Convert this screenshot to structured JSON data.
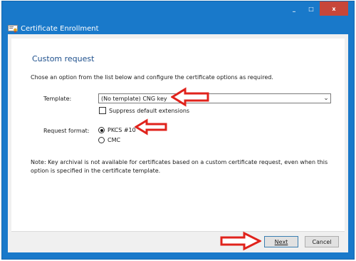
{
  "window": {
    "title": "Certificate Enrollment",
    "caption": {
      "minimize": "_",
      "maximize": "□",
      "close": "x"
    }
  },
  "page": {
    "heading": "Custom request",
    "instructions": "Chose an option from the list below and configure the certificate options as required."
  },
  "template": {
    "label": "Template:",
    "selected": "(No template) CNG key",
    "suppress_label": "Suppress default extensions",
    "suppress_checked": false
  },
  "request_format": {
    "label": "Request format:",
    "options": [
      {
        "label": "PKCS #10",
        "selected": true
      },
      {
        "label": "CMC",
        "selected": false
      }
    ]
  },
  "note": "Note: Key archival is not available for certificates based on a custom certificate request, even when this option is specified in the certificate template.",
  "buttons": {
    "next": "Next",
    "cancel": "Cancel"
  },
  "annotations": {
    "arrow_color": "#e0231c"
  },
  "icons": [
    "certificate-icon",
    "chevron-down-icon",
    "minimize-icon",
    "maximize-icon",
    "close-icon"
  ]
}
